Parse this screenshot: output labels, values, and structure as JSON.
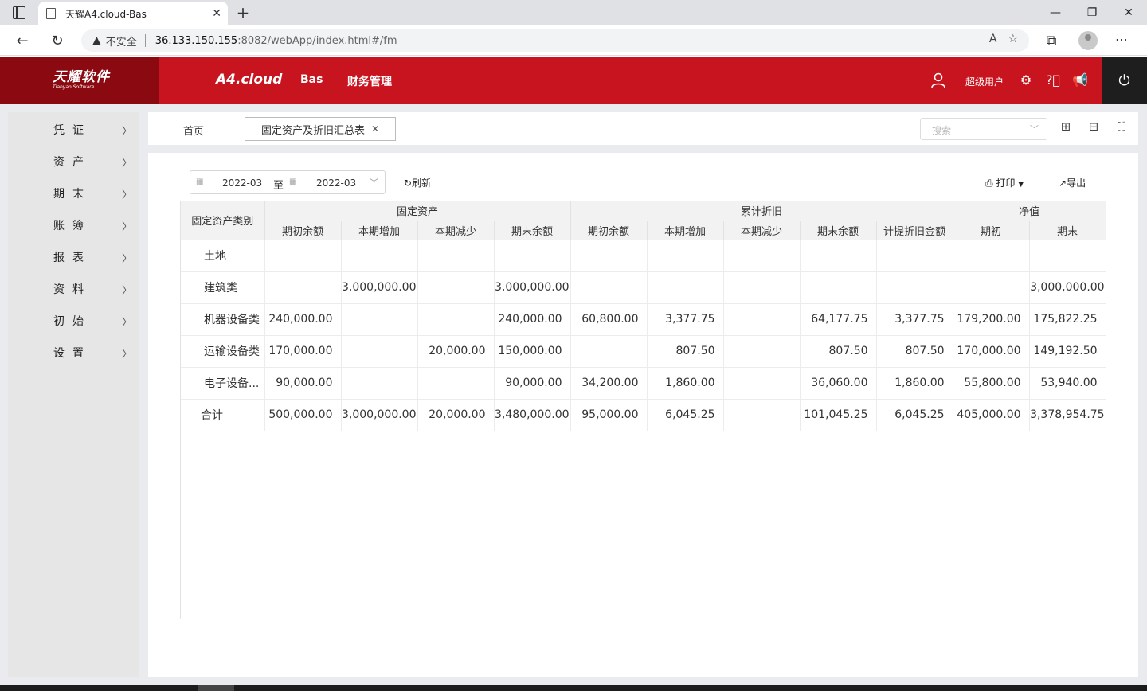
{
  "browser": {
    "tab_title": "天耀A4.cloud-Bas",
    "security_label": "不安全",
    "url_host": "36.133.150.155",
    "url_rest": ":8082/webApp/index.html#/fm"
  },
  "header": {
    "logo_cn": "天耀软件",
    "logo_en": "Tianyao Software",
    "brand": "A4.cloud",
    "menu": [
      "Bas",
      "财务管理"
    ],
    "username": "超级用户"
  },
  "sidebar": {
    "items": [
      {
        "label": "凭证"
      },
      {
        "label": "资产"
      },
      {
        "label": "期末"
      },
      {
        "label": "账簿"
      },
      {
        "label": "报表"
      },
      {
        "label": "资料"
      },
      {
        "label": "初始"
      },
      {
        "label": "设置"
      }
    ]
  },
  "tabs": {
    "home": "首页",
    "active": "固定资产及折旧汇总表"
  },
  "search": {
    "placeholder": "搜索"
  },
  "toolbar": {
    "date_from": "2022-03",
    "date_sep": "至",
    "date_to": "2022-03",
    "refresh": "刷新",
    "print": "打印",
    "export": "导出"
  },
  "table": {
    "row_header": "固定资产类别",
    "groups": [
      "固定资产",
      "累计折旧",
      "净值"
    ],
    "subheaders": [
      "期初余额",
      "本期增加",
      "本期减少",
      "期末余额",
      "期初余额",
      "本期增加",
      "本期减少",
      "期末余额",
      "计提折旧金额",
      "期初",
      "期末"
    ],
    "rows": [
      {
        "category": "土地",
        "cells": [
          "",
          "",
          "",
          "",
          "",
          "",
          "",
          "",
          "",
          "",
          ""
        ]
      },
      {
        "category": "建筑类",
        "cells": [
          "",
          "3,000,000.00",
          "",
          "3,000,000.00",
          "",
          "",
          "",
          "",
          "",
          "",
          "3,000,000.00"
        ]
      },
      {
        "category": "机器设备类",
        "cells": [
          "240,000.00",
          "",
          "",
          "240,000.00",
          "60,800.00",
          "3,377.75",
          "",
          "64,177.75",
          "3,377.75",
          "179,200.00",
          "175,822.25"
        ]
      },
      {
        "category": "运输设备类",
        "cells": [
          "170,000.00",
          "",
          "20,000.00",
          "150,000.00",
          "",
          "807.50",
          "",
          "807.50",
          "807.50",
          "170,000.00",
          "149,192.50"
        ]
      },
      {
        "category": "电子设备...",
        "cells": [
          "90,000.00",
          "",
          "",
          "90,000.00",
          "34,200.00",
          "1,860.00",
          "",
          "36,060.00",
          "1,860.00",
          "55,800.00",
          "53,940.00"
        ]
      },
      {
        "category": "合计",
        "cells": [
          "500,000.00",
          "3,000,000.00",
          "20,000.00",
          "3,480,000.00",
          "95,000.00",
          "6,045.25",
          "",
          "101,045.25",
          "6,045.25",
          "405,000.00",
          "3,378,954.75"
        ]
      }
    ]
  }
}
